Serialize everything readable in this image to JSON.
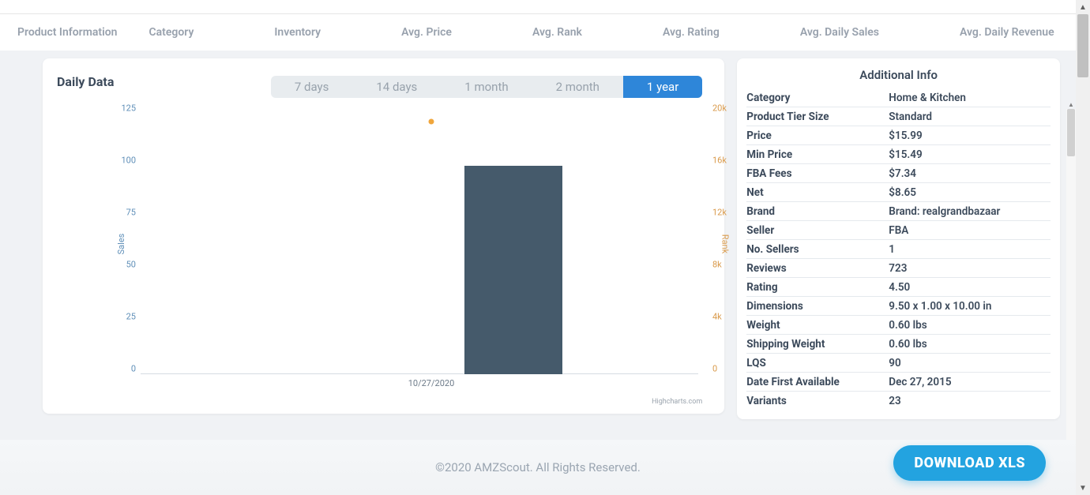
{
  "tabs": {
    "left": "Product Information",
    "right": [
      "Category",
      "Inventory",
      "Avg. Price",
      "Avg. Rank",
      "Avg. Rating",
      "Avg. Daily Sales",
      "Avg. Daily Revenue"
    ]
  },
  "chart": {
    "title": "Daily Data",
    "ranges": [
      "7 days",
      "14 days",
      "1 month",
      "2 month",
      "1 year"
    ],
    "active_range_index": 4,
    "left_axis_label": "Sales",
    "right_axis_label": "Rank",
    "left_ticks": [
      "0",
      "25",
      "50",
      "75",
      "100",
      "125"
    ],
    "right_ticks": [
      "0",
      "4k",
      "8k",
      "12k",
      "16k",
      "20k"
    ],
    "x_label": "10/27/2020",
    "credit": "Highcharts.com"
  },
  "chart_data": {
    "type": "bar",
    "categories": [
      "10/27/2020"
    ],
    "series": [
      {
        "name": "Sales",
        "axis": "left",
        "kind": "bar",
        "values": [
          100
        ]
      },
      {
        "name": "Rank",
        "axis": "right",
        "kind": "point",
        "values": [
          19000
        ]
      }
    ],
    "y_left": {
      "label": "Sales",
      "lim": [
        0,
        125
      ],
      "ticks": [
        0,
        25,
        50,
        75,
        100,
        125
      ]
    },
    "y_right": {
      "label": "Rank",
      "lim": [
        0,
        20000
      ],
      "ticks": [
        0,
        4000,
        8000,
        12000,
        16000,
        20000
      ]
    },
    "title": "Daily Data"
  },
  "info": {
    "title": "Additional Info",
    "rows": [
      {
        "k": "Category",
        "v": "Home & Kitchen"
      },
      {
        "k": "Product Tier Size",
        "v": "Standard"
      },
      {
        "k": "Price",
        "v": "$15.99"
      },
      {
        "k": "Min Price",
        "v": "$15.49"
      },
      {
        "k": "FBA Fees",
        "v": "$7.34"
      },
      {
        "k": "Net",
        "v": "$8.65"
      },
      {
        "k": "Brand",
        "v": "Brand: realgrandbazaar"
      },
      {
        "k": "Seller",
        "v": "FBA"
      },
      {
        "k": "No. Sellers",
        "v": "1"
      },
      {
        "k": "Reviews",
        "v": "723"
      },
      {
        "k": "Rating",
        "v": "4.50"
      },
      {
        "k": "Dimensions",
        "v": "9.50 x 1.00 x 10.00 in"
      },
      {
        "k": "Weight",
        "v": "0.60 lbs"
      },
      {
        "k": "Shipping Weight",
        "v": "0.60 lbs"
      },
      {
        "k": "LQS",
        "v": "90"
      },
      {
        "k": "Date First Available",
        "v": "Dec 27, 2015"
      },
      {
        "k": "Variants",
        "v": "23"
      }
    ]
  },
  "footer": "©2020 AMZScout. All Rights Reserved.",
  "download_label": "DOWNLOAD XLS"
}
